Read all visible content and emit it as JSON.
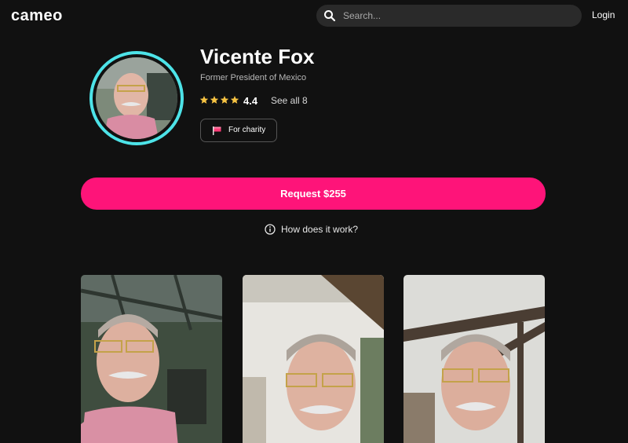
{
  "nav": {
    "logo": "cameo",
    "search_placeholder": "Search...",
    "login_label": "Login"
  },
  "profile": {
    "name": "Vicente Fox",
    "subtitle": "Former President of Mexico",
    "rating": "4.4",
    "stars_filled": 4,
    "see_all_label": "See all 8",
    "charity_label": "For charity"
  },
  "actions": {
    "request_label": "Request $255",
    "how_label": "How does it work?"
  },
  "colors": {
    "accent": "#fe1479",
    "avatar_ring": "#4de3e8",
    "star": "#f5c242",
    "background": "#111111"
  },
  "icons": {
    "search": "search-icon",
    "star": "star-icon",
    "flag": "flag-icon",
    "info": "info-icon"
  }
}
